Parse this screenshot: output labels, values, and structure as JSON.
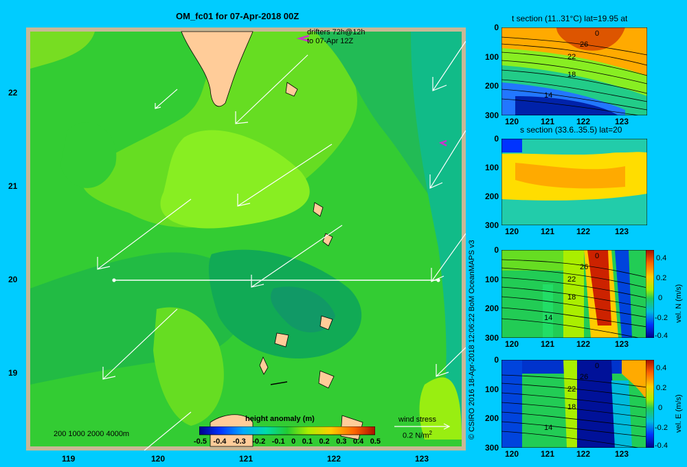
{
  "main": {
    "title": "OM_fc01 for 07-Apr-2018 00Z",
    "drifters_line1": "drifters 72h@12h",
    "drifters_line2": "to 07-Apr 12Z",
    "x_ticks": [
      "119",
      "120",
      "121",
      "122",
      "123"
    ],
    "y_ticks": [
      "22",
      "21",
      "20",
      "19"
    ],
    "depth_legend": "200  1000  2000  4000m",
    "colorbar_title": "height anomaly (m)",
    "colorbar_ticks": [
      "-0.5",
      "-0.4",
      "-0.3",
      "-0.2",
      "-0.1",
      "0",
      "0.1",
      "0.2",
      "0.3",
      "0.4",
      "0.5"
    ],
    "wind_stress_label": "wind stress",
    "wind_stress_scale": "0.2 N/m",
    "wind_stress_exp": "2",
    "section_latitude_deg": 20
  },
  "credit": "© CSIRO 2016   18-Apr-2018 12:06:22 BoM OceanMAPS v3",
  "panels": [
    {
      "title": "t section (11..31°C) lat=19.95 at",
      "contours": [
        "0",
        "26",
        "22",
        "18",
        "14"
      ]
    },
    {
      "title": "s section (33.6..35.5) lat=20",
      "contours": []
    },
    {
      "title": "",
      "contours": [
        "0",
        "26",
        "22",
        "18",
        "14"
      ],
      "colorbar_label": "vel. N  (m/s)",
      "colorbar_ticks": [
        "0.4",
        "0.2",
        "0",
        "-0.2",
        "-0.4"
      ]
    },
    {
      "title": "",
      "contours": [
        "0",
        "26",
        "22",
        "18",
        "14"
      ],
      "colorbar_label": "vel. E  (m/s)",
      "colorbar_ticks": [
        "0.4",
        "0.2",
        "0",
        "-0.2",
        "-0.4"
      ]
    }
  ],
  "panel_x_ticks": [
    "120",
    "121",
    "122",
    "123"
  ],
  "panel_y_ticks": [
    "0",
    "100",
    "200",
    "300"
  ],
  "colors": {
    "background": "#00ccff",
    "land": "#ffcc99",
    "frame": "#c8b896",
    "drifter": "#cc33cc"
  },
  "icons": {
    "wind_vectors": "arrow-icon",
    "drifter_marker": "chevron-icon"
  }
}
